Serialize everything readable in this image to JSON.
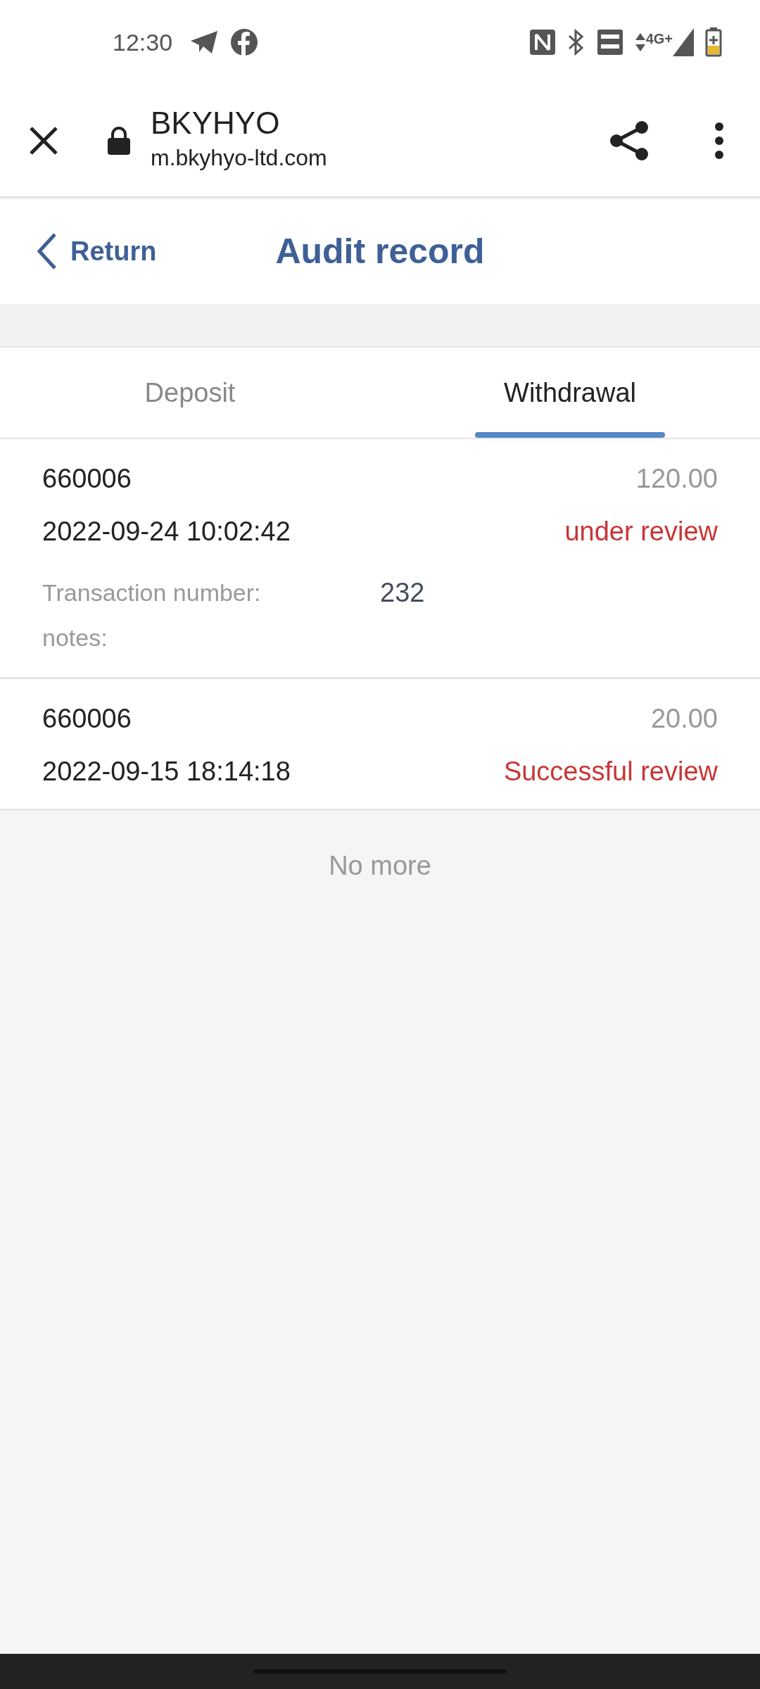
{
  "status_bar": {
    "time": "12:30",
    "network": "4G+"
  },
  "browser_bar": {
    "title": "BKYHYO",
    "url": "m.bkyhyo-ltd.com"
  },
  "header": {
    "back_label": "Return",
    "title": "Audit record"
  },
  "tabs": [
    {
      "label": "Deposit",
      "selected": false
    },
    {
      "label": "Withdrawal",
      "selected": true
    }
  ],
  "records": [
    {
      "account": "660006",
      "amount": "120.00",
      "datetime": "2022-09-24 10:02:42",
      "status": "under review",
      "details": [
        {
          "label": "Transaction number:",
          "value": "232"
        },
        {
          "label": "notes:"
        }
      ]
    },
    {
      "account": "660006",
      "amount": "20.00",
      "datetime": "2022-09-15 18:14:18",
      "status": "Successful review"
    }
  ],
  "footer_text": "No more"
}
